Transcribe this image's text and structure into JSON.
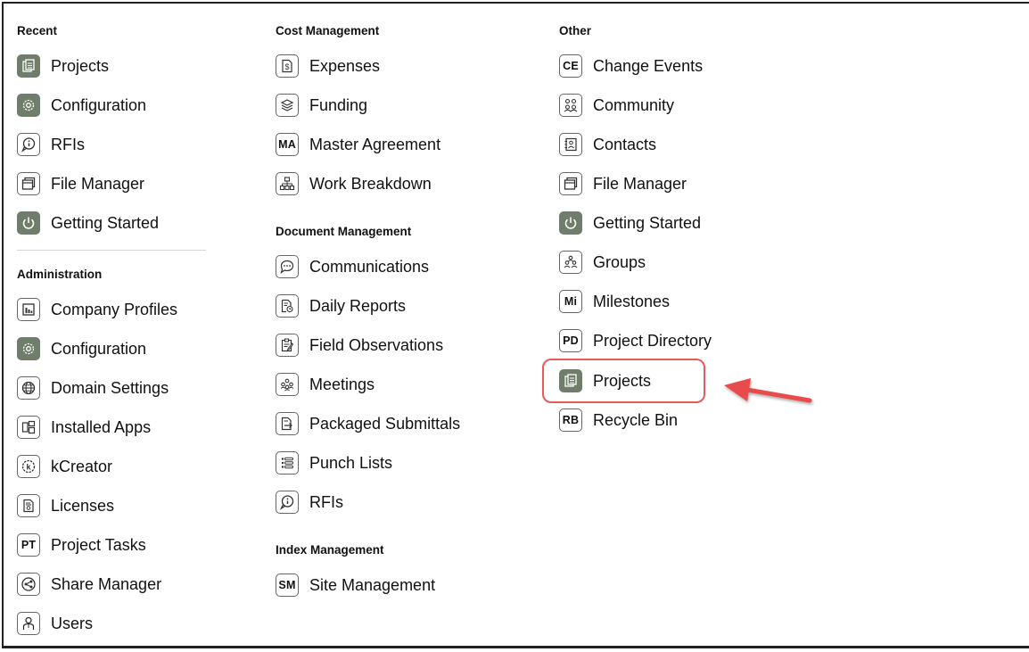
{
  "sections": {
    "recent": {
      "title": "Recent",
      "items": [
        {
          "label": "Projects",
          "icon": "projects-icon"
        },
        {
          "label": "Configuration",
          "icon": "gear-icon"
        },
        {
          "label": "RFIs",
          "icon": "info-bubble-icon"
        },
        {
          "label": "File Manager",
          "icon": "file-manager-icon"
        },
        {
          "label": "Getting Started",
          "icon": "power-icon"
        }
      ]
    },
    "administration": {
      "title": "Administration",
      "items": [
        {
          "label": "Company Profiles",
          "icon": "company-icon"
        },
        {
          "label": "Configuration",
          "icon": "gear-icon"
        },
        {
          "label": "Domain Settings",
          "icon": "globe-icon"
        },
        {
          "label": "Installed Apps",
          "icon": "apps-icon"
        },
        {
          "label": "kCreator",
          "icon": "kcreator-icon"
        },
        {
          "label": "Licenses",
          "icon": "license-icon"
        },
        {
          "label": "Project Tasks",
          "abbr": "PT"
        },
        {
          "label": "Share Manager",
          "icon": "share-icon"
        },
        {
          "label": "Users",
          "icon": "user-icon"
        }
      ]
    },
    "cost_management": {
      "title": "Cost Management",
      "items": [
        {
          "label": "Expenses",
          "icon": "expenses-icon"
        },
        {
          "label": "Funding",
          "icon": "funding-icon"
        },
        {
          "label": "Master Agreement",
          "abbr": "MA"
        },
        {
          "label": "Work Breakdown",
          "icon": "hierarchy-icon"
        }
      ]
    },
    "document_management": {
      "title": "Document Management",
      "items": [
        {
          "label": "Communications",
          "icon": "chat-icon"
        },
        {
          "label": "Daily Reports",
          "icon": "daily-report-icon"
        },
        {
          "label": "Field Observations",
          "icon": "observation-icon"
        },
        {
          "label": "Meetings",
          "icon": "meeting-icon"
        },
        {
          "label": "Packaged Submittals",
          "icon": "submittal-icon"
        },
        {
          "label": "Punch Lists",
          "icon": "list-icon"
        },
        {
          "label": "RFIs",
          "icon": "info-bubble-icon"
        }
      ]
    },
    "index_management": {
      "title": "Index Management",
      "items": [
        {
          "label": "Site Management",
          "abbr": "SM"
        }
      ]
    },
    "other": {
      "title": "Other",
      "items": [
        {
          "label": "Change Events",
          "abbr": "CE"
        },
        {
          "label": "Community",
          "icon": "community-icon"
        },
        {
          "label": "Contacts",
          "icon": "contacts-icon"
        },
        {
          "label": "File Manager",
          "icon": "file-manager-icon"
        },
        {
          "label": "Getting Started",
          "icon": "power-icon"
        },
        {
          "label": "Groups",
          "icon": "groups-icon"
        },
        {
          "label": "Milestones",
          "abbr": "Mi"
        },
        {
          "label": "Project Directory",
          "abbr": "PD"
        },
        {
          "label": "Projects",
          "icon": "projects-icon"
        },
        {
          "label": "Recycle Bin",
          "abbr": "RB"
        }
      ]
    }
  },
  "colors": {
    "accent_icon_bg": "#6f7d6a",
    "highlight": "#e85a5a"
  }
}
